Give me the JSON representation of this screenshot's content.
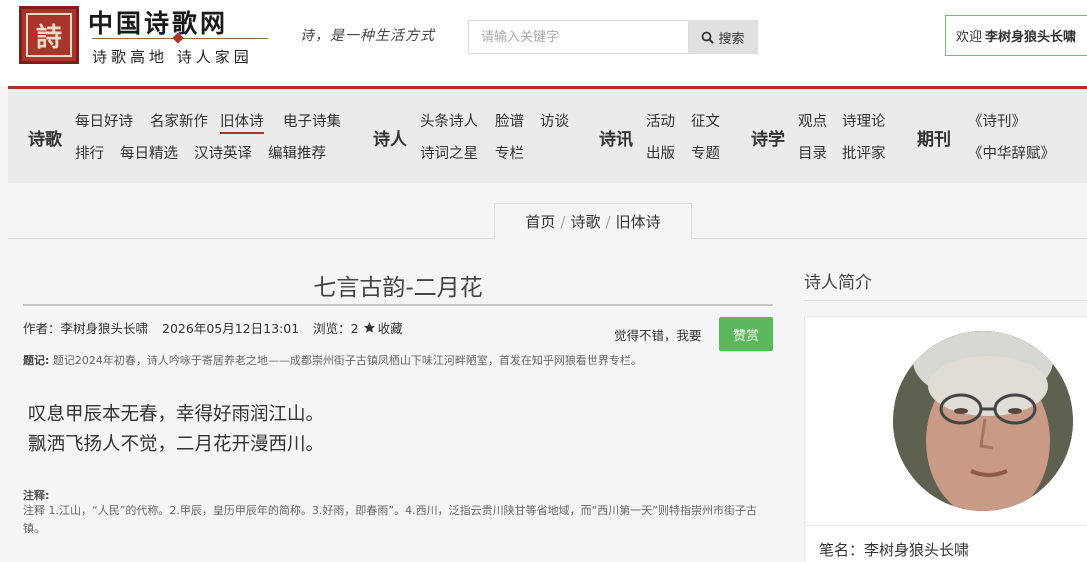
{
  "header": {
    "logo_seal_char": "詩",
    "site_title": "中国诗歌网",
    "site_subtitle": "诗歌高地 诗人家园",
    "slogan": "诗，是一种生活方式",
    "search_placeholder": "请输入关键字",
    "search_button": "搜索",
    "welcome_prefix": "欢迎",
    "welcome_user": "李树身狼头长啸"
  },
  "nav": {
    "poetry": {
      "label": "诗歌",
      "row1": [
        "每日好诗",
        "名家新作",
        "旧体诗",
        "电子诗集"
      ],
      "row2": [
        "排行",
        "每日精选",
        "汉诗英译",
        "编辑推荐"
      ],
      "active": "旧体诗"
    },
    "poets": {
      "label": "诗人",
      "row1": [
        "头条诗人",
        "脸谱",
        "访谈"
      ],
      "row2": [
        "诗词之星",
        "专栏"
      ]
    },
    "news": {
      "label": "诗讯",
      "row1": [
        "活动",
        "征文"
      ],
      "row2": [
        "出版",
        "专题"
      ]
    },
    "studies": {
      "label": "诗学",
      "row1": [
        "观点",
        "诗理论"
      ],
      "row2": [
        "目录",
        "批评家"
      ]
    },
    "journal": {
      "label": "期刊",
      "row1": [
        "《诗刊》"
      ],
      "row2": [
        "《中华辞赋》"
      ]
    }
  },
  "breadcrumb": [
    "首页",
    "诗歌",
    "旧体诗"
  ],
  "article": {
    "title": "七言古韵-二月花",
    "author": "作者：李树身狼头长啸",
    "date": "2026年05月12日13:01",
    "views": "浏览：2",
    "favorite": "收藏",
    "like_text": "觉得不错，我要",
    "reward_button": "赞赏",
    "preface_label": "题记:",
    "preface": "题记2024年初春，诗人吟咏于寄居养老之地——成都崇州街子古镇凤栖山下味江河畔陋室，首发在知乎网狼看世界专栏。",
    "poem_lines": [
      "叹息甲辰本无春，幸得好雨润江山。",
      "飘洒飞扬人不觉，二月花开漫西川。"
    ],
    "notes_label": "注释:",
    "notes": "注释 1.江山，“人民”的代称。2.甲辰，皇历甲辰年的简称。3.好雨，即春雨”。4.西川，泛指云贵川陕甘等省地域，而“西川第一天”则特指崇州市街子古镇。"
  },
  "sidebar": {
    "title": "诗人简介",
    "pen_name": "笔名：李树身狼头长啸"
  },
  "colors": {
    "brand_red": "#a8352b",
    "reward_green": "#5cb85c",
    "nav_bg": "#ebebeb"
  }
}
